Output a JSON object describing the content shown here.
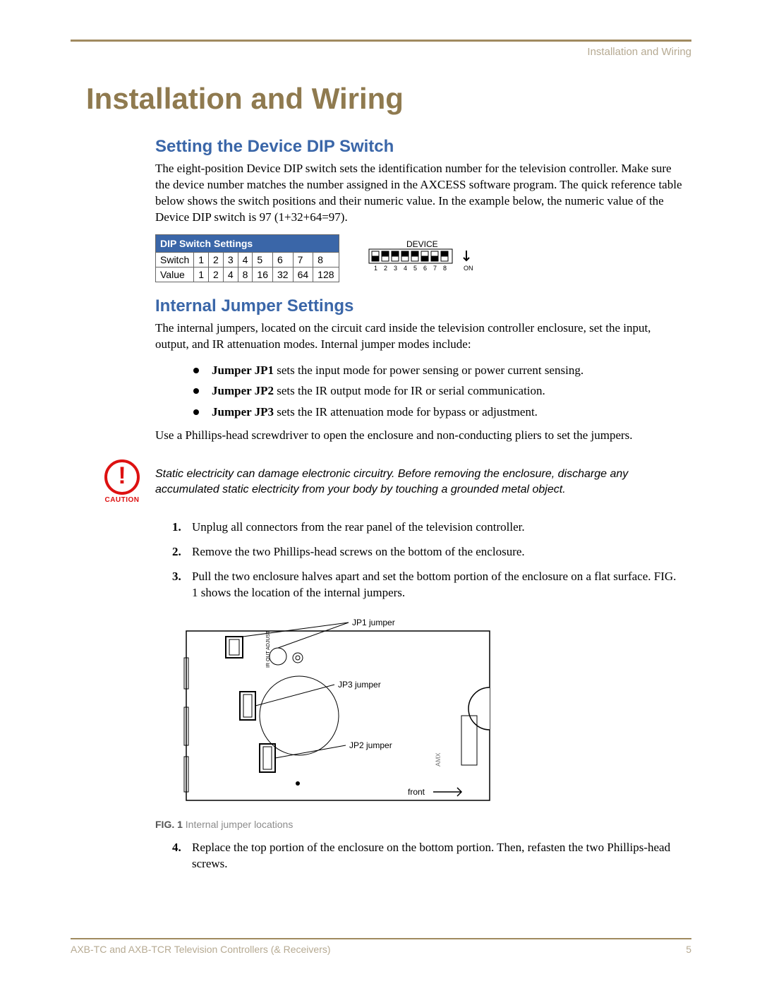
{
  "running_head": "Installation and Wiring",
  "title": "Installation and Wiring",
  "section1": {
    "heading": "Setting the Device DIP Switch",
    "para": "The eight-position Device DIP switch sets the identification number for the television controller. Make sure the device number matches the number assigned in the AXCESS software program. The quick reference table below shows the switch positions and their numeric value. In the example below, the numeric value of the Device DIP switch is 97 (1+32+64=97)."
  },
  "dip_table": {
    "title": "DIP Switch Settings",
    "row_labels": [
      "Switch",
      "Value"
    ],
    "switch": [
      "1",
      "2",
      "3",
      "4",
      "5",
      "6",
      "7",
      "8"
    ],
    "value": [
      "1",
      "2",
      "4",
      "8",
      "16",
      "32",
      "64",
      "128"
    ]
  },
  "dip_diagram": {
    "label": "DEVICE",
    "positions": [
      "1",
      "2",
      "3",
      "4",
      "5",
      "6",
      "7",
      "8"
    ],
    "on_label": "ON"
  },
  "section2": {
    "heading": "Internal Jumper Settings",
    "intro": "The internal jumpers, located on the circuit card inside the television controller enclosure, set the input, output, and IR attenuation modes. Internal jumper modes include:",
    "bullets": [
      {
        "lead": "Jumper JP1",
        "rest": " sets the input mode for power sensing or power current sensing."
      },
      {
        "lead": "Jumper JP2",
        "rest": " sets the IR output mode for IR or serial communication."
      },
      {
        "lead": "Jumper JP3",
        "rest": " sets the IR attenuation mode for bypass or adjustment."
      }
    ],
    "after_bullets": "Use a Phillips-head screwdriver to open the enclosure and non-conducting pliers to set the jumpers."
  },
  "caution": {
    "label": "CAUTION",
    "text": "Static electricity can damage electronic circuitry. Before removing the enclosure, discharge any accumulated static electricity from your body by touching a grounded metal object."
  },
  "steps_part1": [
    "Unplug all connectors from the rear panel of the television controller.",
    "Remove the two Phillips-head screws on the bottom of the enclosure.",
    "Pull the two enclosure halves apart and set the bottom portion of the enclosure on a flat surface. FIG. 1 shows the location of the internal jumpers."
  ],
  "figure": {
    "labels": {
      "jp1": "JP1 jumper",
      "jp2": "JP2 jumper",
      "jp3": "JP3 jumper",
      "front": "front",
      "ir_out_adjust": "IR OUT ADJUST"
    },
    "caption_lead": "FIG. 1",
    "caption_rest": "  Internal jumper locations"
  },
  "steps_part2": [
    "Replace the top portion of the enclosure on the bottom portion. Then, refasten the two Phillips-head screws."
  ],
  "footer": {
    "doc": "AXB-TC and AXB-TCR Television Controllers (& Receivers)",
    "page": "5"
  }
}
